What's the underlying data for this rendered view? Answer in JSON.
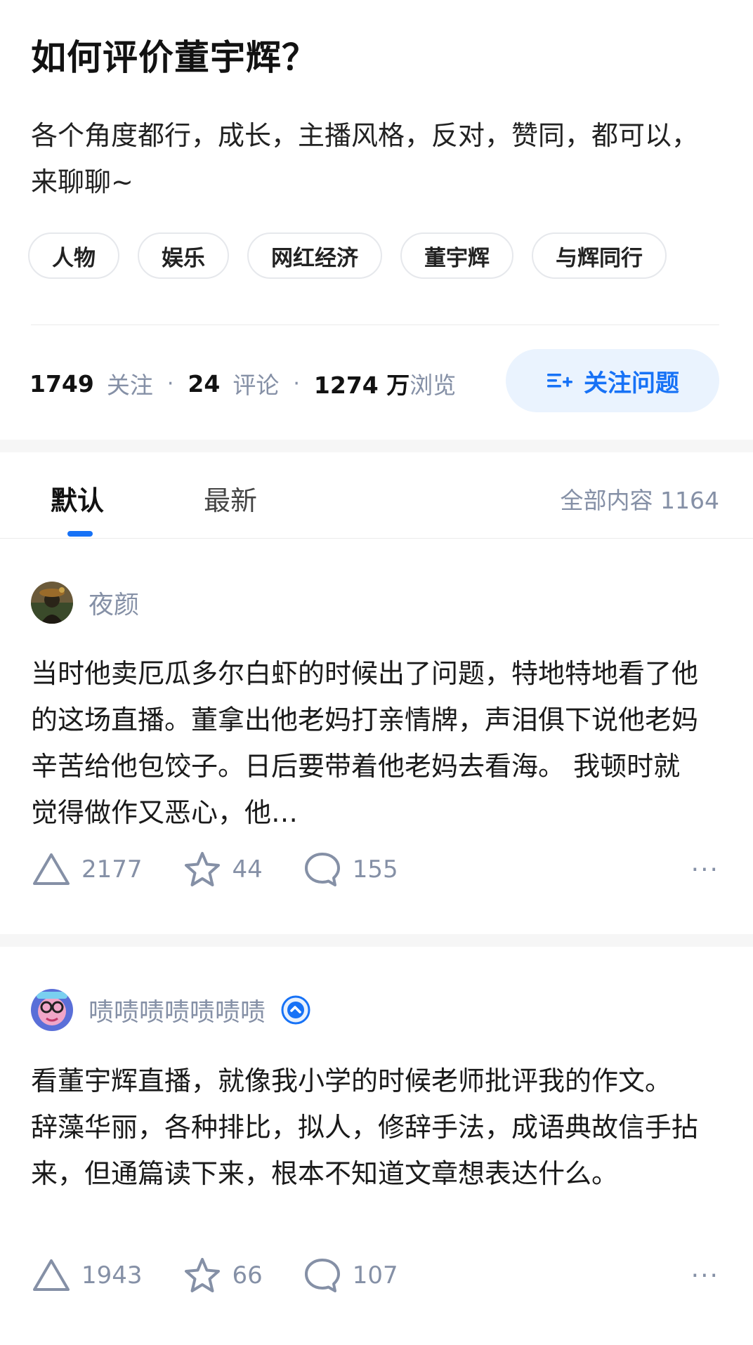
{
  "question": {
    "title": "如何评价董宇辉？",
    "description": "各个角度都行，成长，主播风格，反对，赞同，都可以，来聊聊~",
    "tags": [
      "人物",
      "娱乐",
      "网红经济",
      "董宇辉",
      "与辉同行"
    ]
  },
  "stats": {
    "followers": "1749",
    "followers_label": "关注",
    "comments": "24",
    "comments_label": "评论",
    "views": "1274 万",
    "views_label": "浏览",
    "separator": "·"
  },
  "follow_button": {
    "label": "关注问题",
    "icon": "add-list-icon"
  },
  "tabs": {
    "default": "默认",
    "newest": "最新",
    "total": "全部内容 1164"
  },
  "answers": [
    {
      "author": "夜颜",
      "content": "当时他卖厄瓜多尔白虾的时候出了问题，特地特地看了他的这场直播。董拿出他老妈打亲情牌，声泪俱下说他老妈辛苦给他包饺子。日后要带着他老妈去看海。 我顿时就觉得做作又恶心，他…",
      "upvotes": "2177",
      "favorites": "44",
      "comments": "155",
      "more": "···"
    },
    {
      "author": "啧啧啧啧啧啧啧",
      "content": "看董宇辉直播，就像我小学的时候老师批评我的作文。 辞藻华丽，各种排比，拟人，修辞手法，成语典故信手拈来，但通篇读下来，根本不知道文章想表达什么。",
      "upvotes": "1943",
      "favorites": "66",
      "comments": "107",
      "more": "···"
    }
  ],
  "colors": {
    "accent": "#1772f6",
    "accent_bg": "#eaf3fe",
    "muted": "#8590a6",
    "band": "#f6f6f6"
  }
}
